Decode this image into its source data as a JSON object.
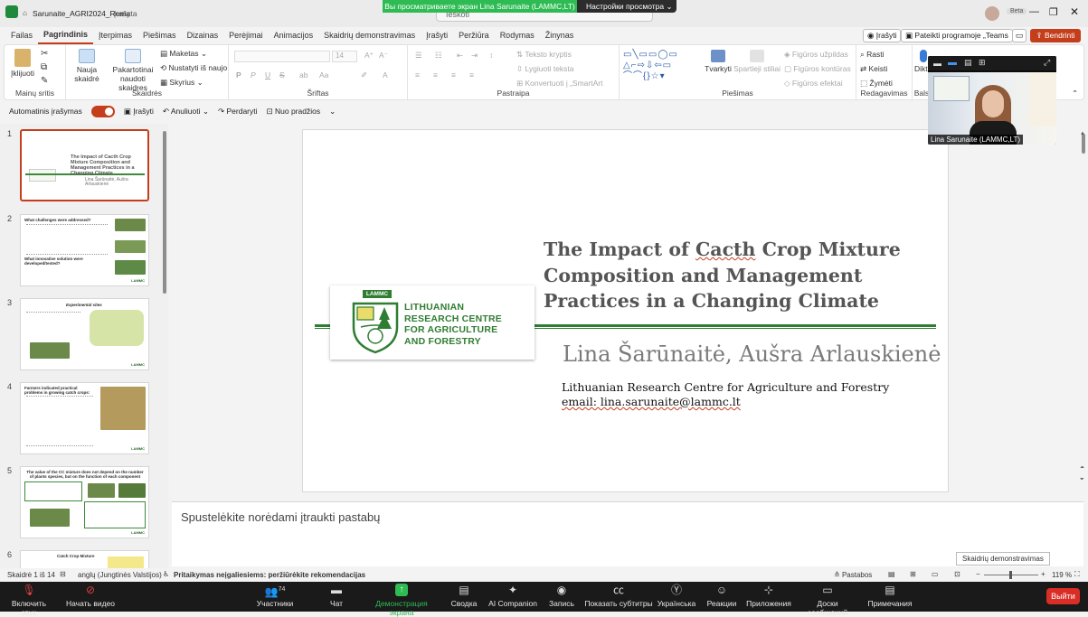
{
  "window": {
    "filename": "Sarunaite_AGRI2024_Roma",
    "save_state": "Įrašyta",
    "search_placeholder": "Ieškoti",
    "user_badge": "Beta"
  },
  "share_banner": {
    "viewing": "Вы просматриваете экран Lina Sarunaite (LAMMC,LT)",
    "settings": "Настройки просмотра"
  },
  "tabs": [
    "Failas",
    "Pagrindinis",
    "Įterpimas",
    "Piešimas",
    "Dizainas",
    "Perėjimai",
    "Animacijos",
    "Skaidrių demonstravimas",
    "Įrašyti",
    "Peržiūra",
    "Rodymas",
    "Žinynas"
  ],
  "ribbon_right": {
    "record": "Įrašyti",
    "teams": "Pateikti programoje „Teams",
    "share": "Bendrinti"
  },
  "ribbon": {
    "clipboard": {
      "paste": "Įklijuoti",
      "label": "Mainų sritis"
    },
    "slides": {
      "new": "Nauja skaidrė",
      "reuse": "Pakartotinai naudoti skaidres",
      "layout": "Maketas",
      "reset": "Nustatyti iš naujo",
      "section": "Skyrius",
      "label": "Skaidrės"
    },
    "font": {
      "size": "14",
      "label": "Šriftas",
      "bold": "P",
      "italic": "P",
      "underline": "U",
      "strike": "S"
    },
    "paragraph": {
      "direction": "Teksto kryptis",
      "align": "Lygiuoti teksta",
      "smartart": "Konvertuoti į „SmartArt",
      "label": "Pastraipa"
    },
    "drawing": {
      "arrange": "Tvarkyti",
      "quickstyles": "Spartieji stiliai",
      "fill": "Figūros užpildas",
      "outline": "Figūros kontūras",
      "effects": "Figūros efektai",
      "label": "Piešimas"
    },
    "editing": {
      "find": "Rasti",
      "replace": "Keisti",
      "select": "Žymėti",
      "label": "Redagavimas"
    },
    "voice": {
      "dictate": "Dikto",
      "label": "Bals"
    }
  },
  "qat": {
    "autosave": "Automatinis įrašymas",
    "record": "Įrašyti",
    "undo": "Anuliuoti",
    "redo": "Perdaryti",
    "from_start": "Nuo pradžios"
  },
  "slide": {
    "title": "The Impact of Cacth Crop Mixture Composition and Management Practices in a Changing Climate",
    "title_lines": [
      "The Impact of Cacth Crop Mixture",
      "Composition and Management",
      "Practices in a Changing Climate"
    ],
    "authors": "Lina Šarūnaitė, Aušra Arlauskienė",
    "institution": "Lithuanian Research Centre for Agriculture and Forestry",
    "email": "email: lina.sarunaite@lammc.lt",
    "logo_badge": "LAMMC",
    "logo_text": [
      "LITHUANIAN",
      "RESEARCH CENTRE",
      "FOR AGRICULTURE",
      "AND FORESTRY"
    ]
  },
  "thumbnails": [
    {
      "n": "1",
      "title": "The Impact of Cacth Crop Mixture Composition and Management Practices in a Changing Climate",
      "authors": "Lina Šarūnaitė, Aušra Arlauskienė"
    },
    {
      "n": "2",
      "title": "What challenges were addressed?",
      "subtitle": "What innovative solution were developed/tested?"
    },
    {
      "n": "3",
      "title": "Experimental sites"
    },
    {
      "n": "4",
      "title": "Farmers indicated practical problems in growing catch crops:"
    },
    {
      "n": "5",
      "title": "The value of the CC mixture does not depend on the number of plants species, but on the function of each component"
    },
    {
      "n": "6",
      "title": "Catch Crop Mixture"
    }
  ],
  "thumb_footer": "LAMMC",
  "notes_placeholder": "Spustelėkite norėdami įtraukti pastabų",
  "tooltip": "Skaidrių demonstravimas",
  "status": {
    "slide": "Skaidrė 1 iš 14",
    "language": "anglų (Jungtinės Valstijos)",
    "accessibility": "Pritaikymas neįgaliesiems: peržiūrėkite rekomendacijas",
    "notes": "Pastabos",
    "zoom": "119 %"
  },
  "video": {
    "name": "Lina Sarunaite (LAMMC,LT)"
  },
  "zoom": {
    "participants_count": "74",
    "buttons": [
      "Включить звук",
      "Начать видео",
      "Участники",
      "Чат",
      "Демонстрация экрана",
      "Сводка",
      "AI Companion",
      "Запись",
      "Показать субтитры",
      "Українська",
      "Реакции",
      "Приложения",
      "Доски сообщений",
      "Примечания"
    ],
    "leave": "Выйти"
  },
  "colors": {
    "accent": "#c43e1c",
    "zoom_share": "#2fbb54",
    "slide_green": "#2f7d32",
    "leave": "#d92e26"
  }
}
